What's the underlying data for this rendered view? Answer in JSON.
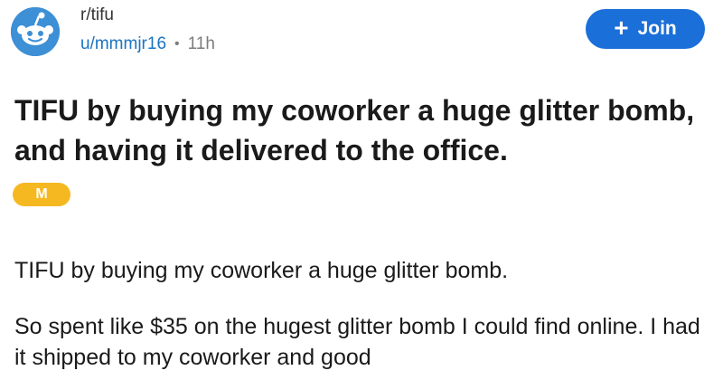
{
  "post": {
    "subreddit": "r/tifu",
    "author": "u/mmmjr16",
    "separator": "•",
    "time": "11h",
    "join_label": "Join",
    "title": "TIFU by buying my coworker a huge glitter bomb, and having it delivered to the office.",
    "flair": "M",
    "paragraphs": [
      "TIFU by buying my coworker a huge glitter bomb.",
      "So spent like $35 on the hugest glitter bomb I could find online. I had it shipped to my coworker and good"
    ]
  },
  "colors": {
    "accent": "#1a6fd9",
    "author_link": "#1a73c2",
    "flair": "#f5b821",
    "avatar_bg": "#3d8fd6"
  },
  "icons": {
    "avatar": "snoo-face-icon",
    "join": "plus-icon"
  }
}
